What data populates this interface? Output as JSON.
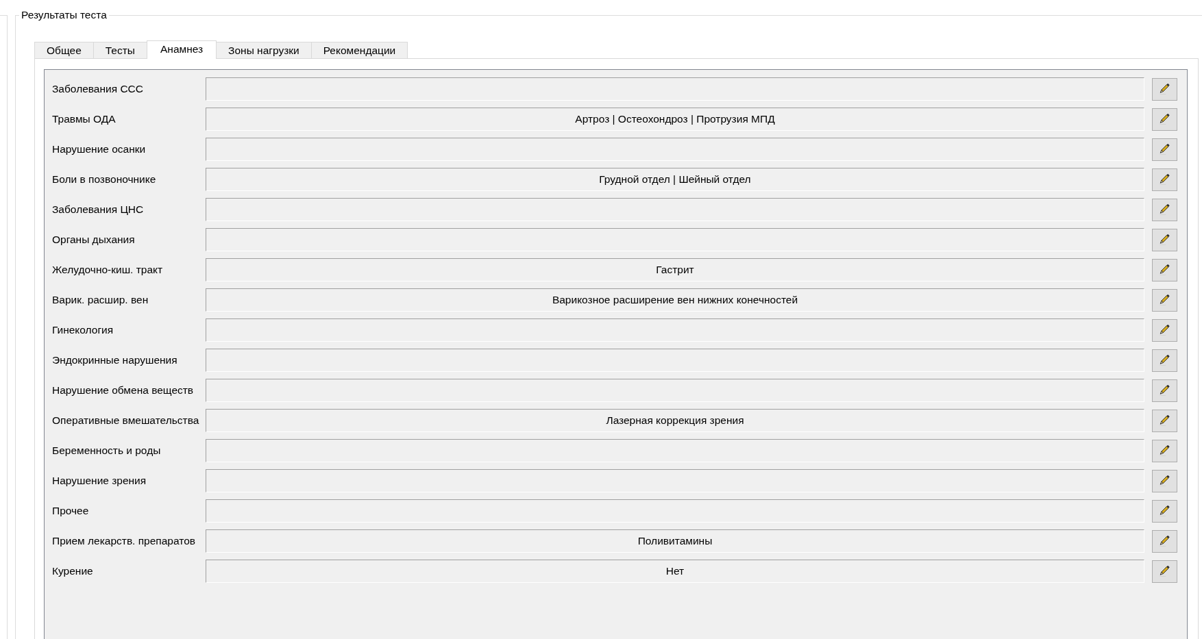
{
  "group_box": {
    "title": "Результаты теста"
  },
  "tabs": [
    {
      "label": "Общее",
      "selected": false
    },
    {
      "label": "Тесты",
      "selected": false
    },
    {
      "label": "Анамнез",
      "selected": true
    },
    {
      "label": "Зоны нагрузки",
      "selected": false
    },
    {
      "label": "Рекомендации",
      "selected": false
    }
  ],
  "anamnesis": [
    {
      "label": "Заболевания ССС"
    },
    {
      "label": "Травмы ОДА",
      "value": "Артроз | Остеохондроз | Протрузия МПД"
    },
    {
      "label": "Нарушение осанки"
    },
    {
      "label": "Боли в позвоночнике",
      "value": "Грудной отдел | Шейный отдел"
    },
    {
      "label": "Заболевания ЦНС"
    },
    {
      "label": "Органы дыхания"
    },
    {
      "label": "Желудочно-киш. тракт",
      "value": "Гастрит"
    },
    {
      "label": "Варик. расшир. вен",
      "value": "Варикозное расширение вен нижних конечностей"
    },
    {
      "label": "Гинекология"
    },
    {
      "label": "Эндокринные нарушения"
    },
    {
      "label": "Нарушение обмена веществ"
    },
    {
      "label": "Оперативные вмешательства",
      "value": "Лазерная коррекция зрения"
    },
    {
      "label": "Беременность и роды"
    },
    {
      "label": "Нарушение зрения"
    },
    {
      "label": "Прочее"
    },
    {
      "label": "Прием лекарств. препаратов",
      "value": "Поливитамины"
    },
    {
      "label": "Курение",
      "value": "Нет"
    }
  ]
}
